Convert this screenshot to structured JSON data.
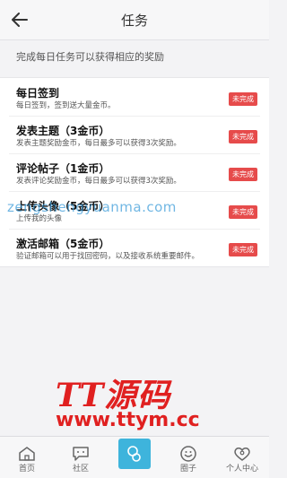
{
  "header": {
    "title": "任务"
  },
  "subtitle": "完成每日任务可以获得相应的奖励",
  "tasks": [
    {
      "title": "每日签到",
      "desc": "每日签到，签到送大量金币。",
      "status": "未完成"
    },
    {
      "title": "发表主题（3金币）",
      "desc": "发表主题奖励金币，每日最多可以获得3次奖励。",
      "status": "未完成"
    },
    {
      "title": "评论帖子（1金币）",
      "desc": "发表评论奖励金币，每日最多可以获得3次奖励。",
      "status": "未完成"
    },
    {
      "title": "上传头像（5金币）",
      "desc": "上传我的头像",
      "status": "未完成"
    },
    {
      "title": "激活邮箱（5金币）",
      "desc": "验证邮箱可以用于找回密码，以及接收系统重要邮件。",
      "status": "未完成"
    }
  ],
  "watermark": "zengshengyuanma.com",
  "logo": {
    "text": "TT源码",
    "url": "www.ttym.cc"
  },
  "tabbar": {
    "items": [
      {
        "label": "首页",
        "icon": "home-icon"
      },
      {
        "label": "社区",
        "icon": "chat-icon"
      },
      {
        "label": "",
        "icon": "add-post-icon"
      },
      {
        "label": "圈子",
        "icon": "circle-icon"
      },
      {
        "label": "个人中心",
        "icon": "heart-user-icon"
      }
    ]
  },
  "colors": {
    "badge": "#e64b4b",
    "accent": "#3eb4dc",
    "logo": "#e02020"
  }
}
